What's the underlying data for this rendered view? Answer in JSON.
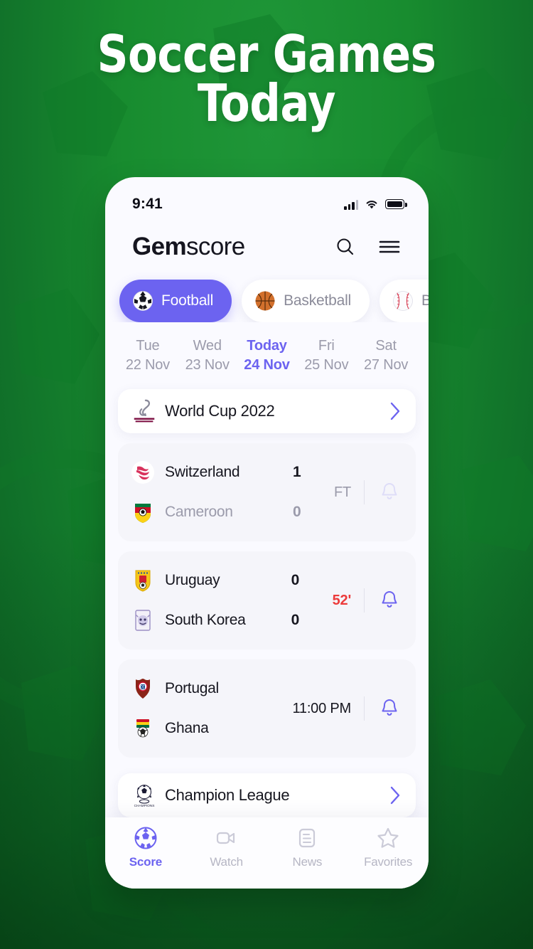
{
  "poster": {
    "title_line1": "Soccer Games",
    "title_line2": "Today",
    "background_color": "#1a8a30",
    "accent_color": "#6c63f0"
  },
  "status_bar": {
    "time": "9:41",
    "signal_icon": "cellular-signal-icon",
    "wifi_icon": "wifi-icon",
    "battery_icon": "battery-icon"
  },
  "header": {
    "brand_bold": "Gem",
    "brand_light": "score",
    "search_icon": "search-icon",
    "menu_icon": "hamburger-menu-icon"
  },
  "sport_tabs": [
    {
      "label": "Football",
      "icon": "soccer-ball-icon",
      "active": true
    },
    {
      "label": "Basketball",
      "icon": "basketball-icon",
      "active": false
    },
    {
      "label": "Baseball",
      "icon": "baseball-icon",
      "active": false
    }
  ],
  "date_strip": [
    {
      "dow": "Tue",
      "date": "22 Nov",
      "today": false
    },
    {
      "dow": "Wed",
      "date": "23 Nov",
      "today": false
    },
    {
      "dow": "Today",
      "date": "24 Nov",
      "today": true
    },
    {
      "dow": "Fri",
      "date": "25 Nov",
      "today": false
    },
    {
      "dow": "Sat",
      "date": "27 Nov",
      "today": false
    }
  ],
  "leagues": [
    {
      "name": "World Cup 2022",
      "logo": "fifa-world-cup-qatar-2022-logo",
      "chevron": "chevron-right-icon"
    },
    {
      "name": "Champion League",
      "logo": "uefa-champions-league-logo",
      "chevron": "chevron-right-icon"
    }
  ],
  "matches": [
    {
      "home": {
        "name": "Switzerland",
        "score": "1",
        "flag": "switzerland-flag",
        "winner": true
      },
      "away": {
        "name": "Cameroon",
        "score": "0",
        "flag": "cameroon-flag",
        "winner": false
      },
      "status_text": "FT",
      "status_type": "ft",
      "bell_icon": "bell-icon",
      "bell_muted": true
    },
    {
      "home": {
        "name": "Uruguay",
        "score": "0",
        "flag": "uruguay-flag",
        "winner": true
      },
      "away": {
        "name": "South Korea",
        "score": "0",
        "flag": "south-korea-flag",
        "winner": true
      },
      "status_text": "52'",
      "status_type": "live",
      "bell_icon": "bell-icon",
      "bell_muted": false
    },
    {
      "home": {
        "name": "Portugal",
        "score": "",
        "flag": "portugal-flag",
        "winner": true
      },
      "away": {
        "name": "Ghana",
        "score": "",
        "flag": "ghana-flag",
        "winner": true
      },
      "status_text": "11:00 PM",
      "status_type": "time",
      "bell_icon": "bell-icon",
      "bell_muted": false
    }
  ],
  "bottom_nav": [
    {
      "label": "Score",
      "icon": "soccer-ball-icon",
      "active": true
    },
    {
      "label": "Watch",
      "icon": "video-camera-icon",
      "active": false
    },
    {
      "label": "News",
      "icon": "news-document-icon",
      "active": false
    },
    {
      "label": "Favorites",
      "icon": "star-icon",
      "active": false
    }
  ]
}
